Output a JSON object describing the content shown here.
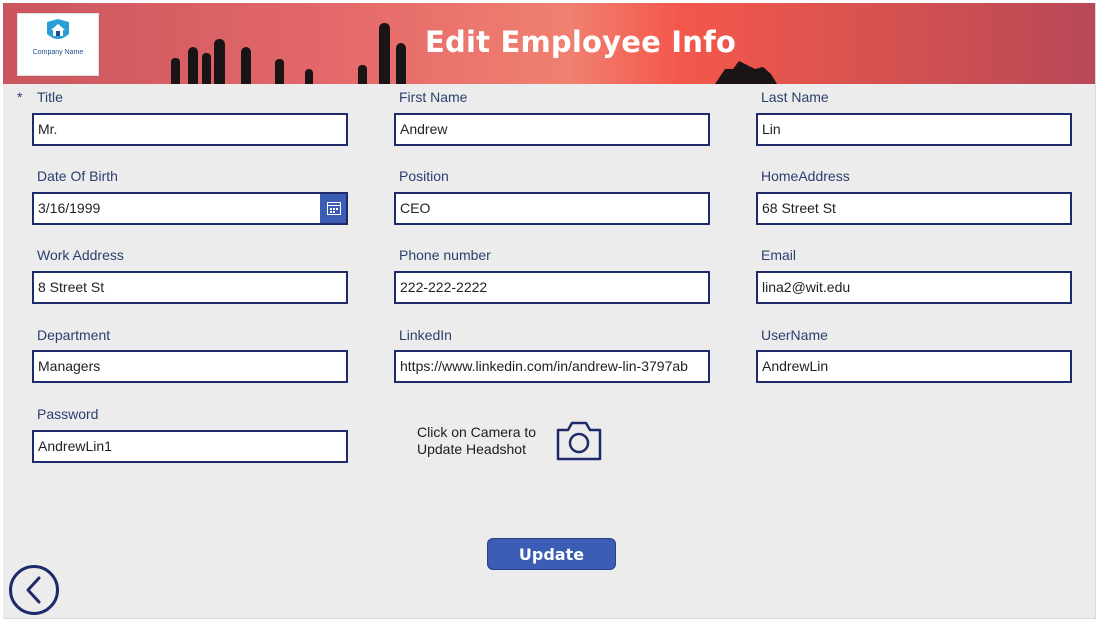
{
  "header": {
    "title": "Edit Employee Info",
    "logo_text": "Company Name",
    "logo_icon": "shield-house-icon"
  },
  "form": {
    "required_marker": "*",
    "title": {
      "label": "Title",
      "value": "Mr."
    },
    "first_name": {
      "label": "First Name",
      "value": "Andrew"
    },
    "last_name": {
      "label": "Last Name",
      "value": "Lin"
    },
    "dob": {
      "label": "Date Of Birth",
      "value": "3/16/1999",
      "icon": "calendar-icon"
    },
    "position": {
      "label": "Position",
      "value": "CEO"
    },
    "home_address": {
      "label": "HomeAddress",
      "value": "68 Street St"
    },
    "work_address": {
      "label": "Work Address",
      "value": "8 Street St"
    },
    "phone": {
      "label": "Phone number",
      "value": "222-222-2222"
    },
    "email": {
      "label": "Email",
      "value": "lina2@wit.edu"
    },
    "department": {
      "label": "Department",
      "value": "Managers"
    },
    "linkedin": {
      "label": "LinkedIn",
      "value": "https://www.linkedin.com/in/andrew-lin-3797ab"
    },
    "username": {
      "label": "UserName",
      "value": "AndrewLin"
    },
    "password": {
      "label": "Password",
      "value": "AndrewLin1"
    }
  },
  "camera": {
    "line1": "Click on Camera to",
    "line2": "Update Headshot",
    "icon": "camera-icon"
  },
  "actions": {
    "update_label": "Update",
    "back_icon": "back-arrow-icon"
  },
  "colors": {
    "accent": "#3c5db5",
    "input_border": "#1f2a6b",
    "label": "#2b3f6e",
    "background": "#ececec"
  }
}
